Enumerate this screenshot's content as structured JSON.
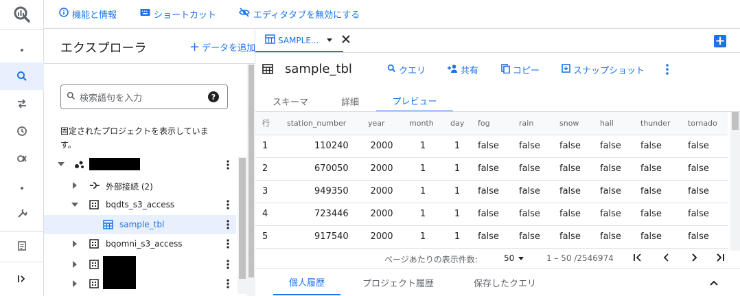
{
  "topbar": {
    "features_label": "機能と情報",
    "shortcuts_label": "ショートカット",
    "disable_tabs_label": "エディタタブを無効にする"
  },
  "explorer": {
    "title": "エクスプローラ",
    "add_data_label": "データを追加",
    "search_placeholder": "検索語句を入力",
    "pinned_text": "固定されたプロジェクトを表示していま\nす。",
    "tree": [
      {
        "label": "外部接続 (2)"
      },
      {
        "label": "bqdts_s3_access"
      },
      {
        "label": "sample_tbl"
      },
      {
        "label": "bqomni_s3_access"
      }
    ]
  },
  "main": {
    "tab_label": "SAMPLE...",
    "table_name": "sample_tbl",
    "actions": [
      "クエリ",
      "共有",
      "コピー",
      "スナップショット"
    ],
    "subtabs": [
      "スキーマ",
      "詳細",
      "プレビュー"
    ],
    "columns": [
      "行",
      "station_number",
      "year",
      "month",
      "day",
      "fog",
      "rain",
      "snow",
      "hail",
      "thunder",
      "tornado"
    ],
    "rows": [
      [
        "1",
        "110240",
        "2000",
        "1",
        "1",
        "false",
        "false",
        "false",
        "false",
        "false",
        "false"
      ],
      [
        "2",
        "670050",
        "2000",
        "1",
        "1",
        "false",
        "false",
        "false",
        "false",
        "false",
        "false"
      ],
      [
        "3",
        "949350",
        "2000",
        "1",
        "1",
        "false",
        "false",
        "false",
        "false",
        "false",
        "false"
      ],
      [
        "4",
        "723446",
        "2000",
        "1",
        "1",
        "false",
        "false",
        "false",
        "false",
        "false",
        "false"
      ],
      [
        "5",
        "917540",
        "2000",
        "1",
        "1",
        "false",
        "false",
        "false",
        "false",
        "false",
        "false"
      ]
    ],
    "pager": {
      "per_page_label": "ページあたりの表示件数:",
      "per_page_value": "50",
      "range": "1 – 50 /2546974"
    },
    "bottom_tabs": [
      "個人履歴",
      "プロジェクト履歴",
      "保存したクエリ"
    ]
  },
  "colors": {
    "accent": "#1a73e8",
    "selected_bg": "#e8f0fe"
  }
}
